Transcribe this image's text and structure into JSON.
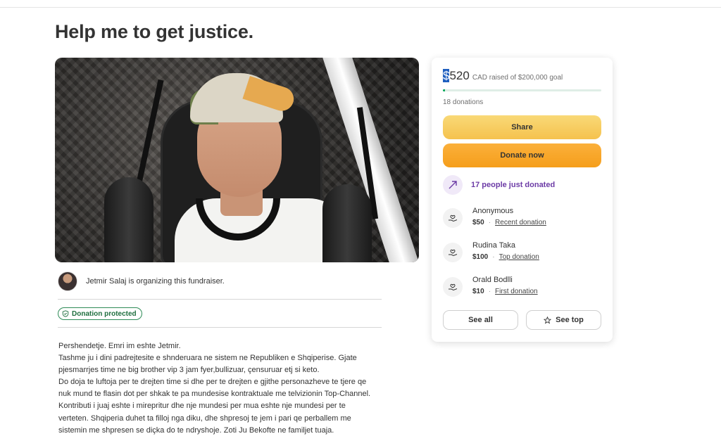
{
  "page": {
    "title": "Help me to get justice."
  },
  "organizer": {
    "text": "Jetmir Salaj is organizing this fundraiser."
  },
  "badge": {
    "label": "Donation protected"
  },
  "story": [
    "Pershendetje. Emri im eshte Jetmir.",
    "Tashme ju i dini padrejtesite e shnderuara ne sistem ne Republiken e Shqiperise. Gjate",
    "pjesmarrjes time ne big brother vip 3 jam fyer,bullizuar, çensuruar etj si keto.",
    "Do doja te luftoja per te drejten time si dhe per te drejten e gjithe personazheve te tjere qe",
    "nuk mund te flasin dot per shkak te pa mundesise kontraktuale me telvizionin Top-Channel.",
    "Kontributi i juaj eshte i mirepritur dhe nje mundesi per mua eshte nje mundesi per te",
    "verteten. Shqiperia duhet ta filloj nga diku, dhe shpresoj te jem i pari qe perballem me",
    "sistemin me shpresen se diçka do te ndryshoje. Zoti Ju Bekofte ne familjet tuaja."
  ],
  "card": {
    "currency_symbol": "$",
    "amount": "520",
    "goal_text": "CAD raised of $200,000 goal",
    "progress_fraction": 0.0026,
    "donations_count": "18 donations",
    "share_label": "Share",
    "donate_label": "Donate now",
    "trend_text": "17 people just donated",
    "donors": [
      {
        "name": "Anonymous",
        "amount": "$50",
        "tag": "Recent donation"
      },
      {
        "name": "Rudina Taka",
        "amount": "$100",
        "tag": "Top donation"
      },
      {
        "name": "Orald Bodlli",
        "amount": "$10",
        "tag": "First donation"
      }
    ],
    "see_all_label": "See all",
    "see_top_label": "See top"
  },
  "colors": {
    "brand_green": "#02a95c",
    "share_yellow": "#f5c24e",
    "donate_orange": "#f59e1b",
    "trend_purple": "#6c3ba6"
  }
}
